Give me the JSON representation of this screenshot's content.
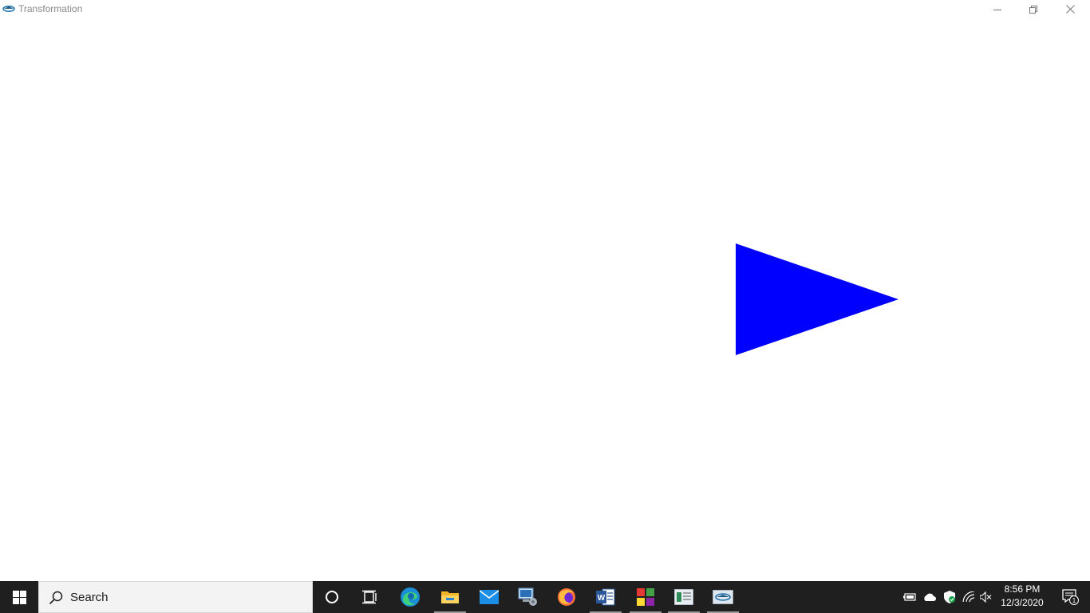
{
  "window": {
    "title": "Transformation",
    "controls": {
      "minimize_icon": "minimize-icon",
      "maximize_icon": "restore-icon",
      "close_icon": "close-icon"
    }
  },
  "canvas": {
    "shape": "triangle",
    "fill": "#0000ff"
  },
  "taskbar": {
    "search_label": "Search",
    "apps": [
      {
        "name": "cortana",
        "icon": "circle-icon"
      },
      {
        "name": "task-view",
        "icon": "task-view-icon"
      },
      {
        "name": "edge",
        "icon": "edge-icon"
      },
      {
        "name": "file-explorer",
        "icon": "folder-icon"
      },
      {
        "name": "mail",
        "icon": "mail-icon"
      },
      {
        "name": "remote-app",
        "icon": "computer-icon"
      },
      {
        "name": "firefox",
        "icon": "firefox-icon"
      },
      {
        "name": "word",
        "icon": "word-icon"
      },
      {
        "name": "colorful-app",
        "icon": "app-tiles-icon"
      },
      {
        "name": "document-app",
        "icon": "document-icon"
      },
      {
        "name": "transformation-app",
        "icon": "app-window-icon"
      }
    ],
    "clock": {
      "time": "8:56 PM",
      "date": "12/3/2020"
    },
    "notification_count": "1",
    "colors": {
      "background": "#1f1f1f",
      "accent": "#0078d7"
    }
  }
}
